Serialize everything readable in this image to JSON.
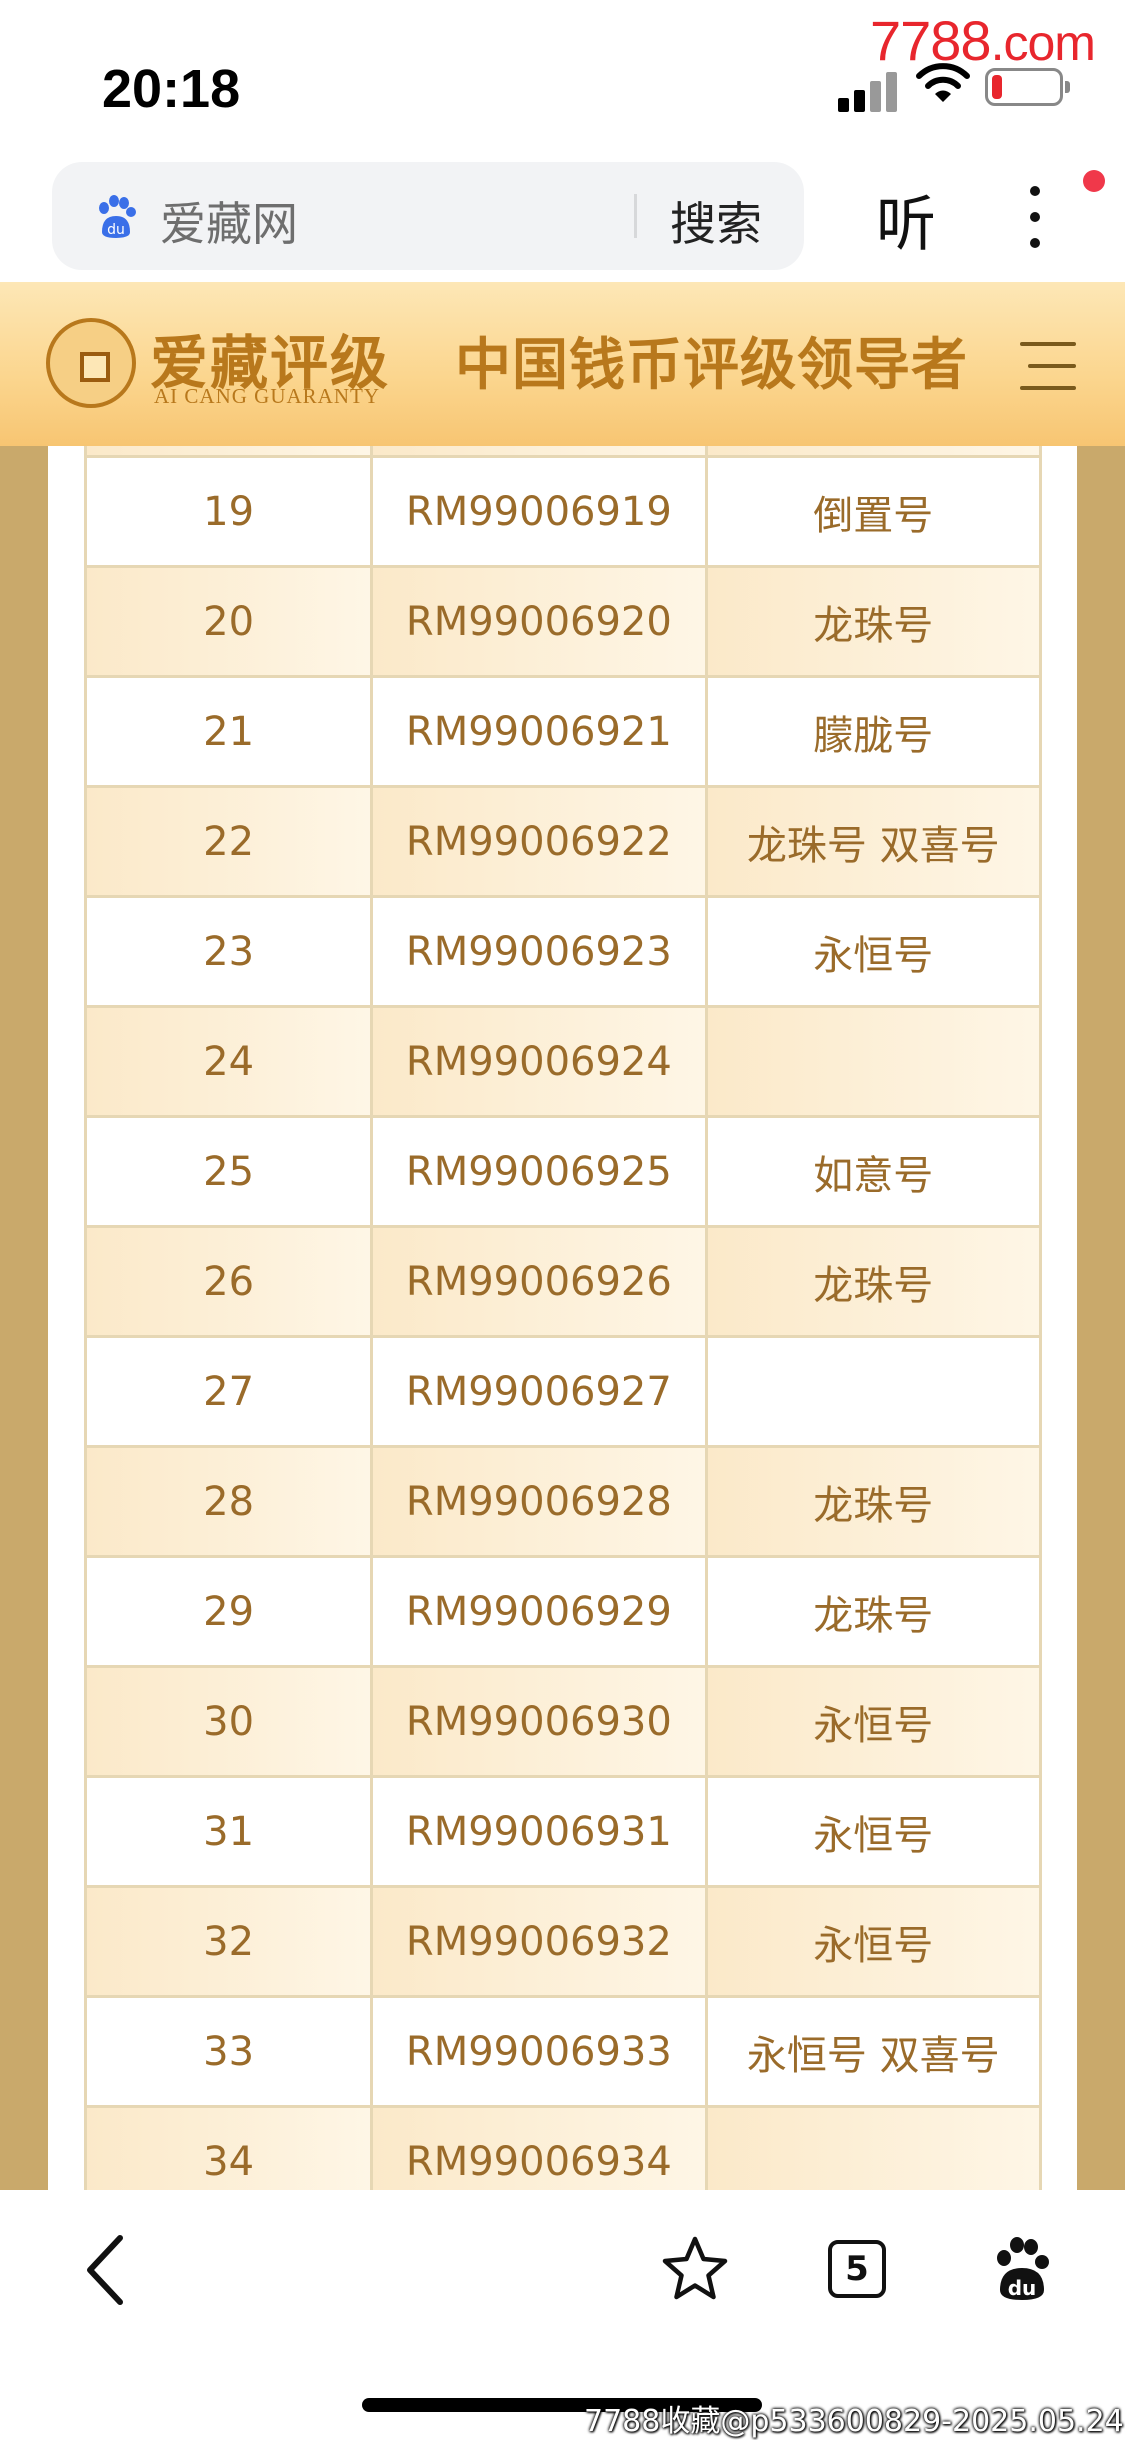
{
  "status_bar": {
    "time": "20:18",
    "watermark": "7788",
    "watermark_suffix": ".com"
  },
  "browser": {
    "search_placeholder": "爱藏网",
    "search_button": "搜索",
    "listen_button": "听"
  },
  "site_header": {
    "brand_cn": "爱藏评级",
    "brand_en": "AI CANG GUARANTY",
    "slogan": "中国钱币评级领导者"
  },
  "table": {
    "rows": [
      {
        "index": "19",
        "code": "RM99006919",
        "tag": "倒置号"
      },
      {
        "index": "20",
        "code": "RM99006920",
        "tag": "龙珠号"
      },
      {
        "index": "21",
        "code": "RM99006921",
        "tag": "朦胧号"
      },
      {
        "index": "22",
        "code": "RM99006922",
        "tag": "龙珠号 双喜号"
      },
      {
        "index": "23",
        "code": "RM99006923",
        "tag": "永恒号"
      },
      {
        "index": "24",
        "code": "RM99006924",
        "tag": ""
      },
      {
        "index": "25",
        "code": "RM99006925",
        "tag": "如意号"
      },
      {
        "index": "26",
        "code": "RM99006926",
        "tag": "龙珠号"
      },
      {
        "index": "27",
        "code": "RM99006927",
        "tag": ""
      },
      {
        "index": "28",
        "code": "RM99006928",
        "tag": "龙珠号"
      },
      {
        "index": "29",
        "code": "RM99006929",
        "tag": "龙珠号"
      },
      {
        "index": "30",
        "code": "RM99006930",
        "tag": "永恒号"
      },
      {
        "index": "31",
        "code": "RM99006931",
        "tag": "永恒号"
      },
      {
        "index": "32",
        "code": "RM99006932",
        "tag": "永恒号"
      },
      {
        "index": "33",
        "code": "RM99006933",
        "tag": "永恒号 双喜号"
      },
      {
        "index": "34",
        "code": "RM99006934",
        "tag": ""
      }
    ]
  },
  "bottom_nav": {
    "tab_count": "5"
  },
  "watermark_bottom": "7788收藏@p533600829-2025.05.24",
  "icons": {
    "search": "baidu-paw-icon",
    "more": "more-vertical-icon",
    "menu": "hamburger-menu-icon",
    "back": "chevron-left-icon",
    "favorite": "star-icon",
    "tabs": "tabs-icon",
    "home": "baidu-paw-icon"
  },
  "colors": {
    "accent_gold": "#b8781c",
    "header_bg": "#fbd58d",
    "side_bg": "#c9a96b",
    "table_text": "#9a6b2a",
    "notification": "#f0384a"
  }
}
